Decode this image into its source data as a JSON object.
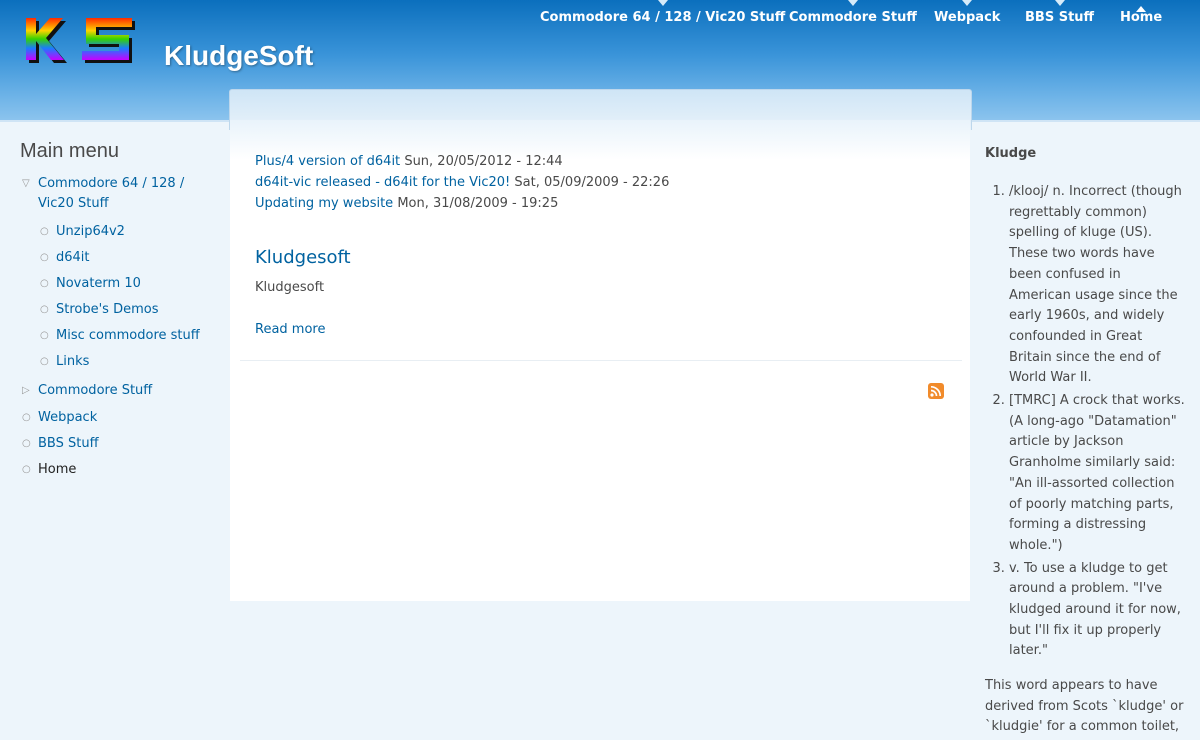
{
  "site": {
    "name": "KludgeSoft",
    "logo_text": "KS",
    "logo_colors": [
      "#ff2a00",
      "#ffd200",
      "#35d300",
      "#1a7cff",
      "#c800ff"
    ]
  },
  "nav": {
    "items": [
      {
        "label": "Commodore 64 / 128 / Vic20 Stuff"
      },
      {
        "label": "Commodore Stuff"
      },
      {
        "label": "Webpack"
      },
      {
        "label": "BBS Stuff"
      },
      {
        "label": "Home"
      }
    ]
  },
  "sidebar_left": {
    "title": "Main menu",
    "items": [
      {
        "label": "Commodore 64 / 128 /",
        "label2": "Vic20 Stuff",
        "bullet": "▽"
      },
      {
        "label": "Unzip64v2",
        "bullet": "○"
      },
      {
        "label": "d64it",
        "bullet": "○"
      },
      {
        "label": "Novaterm 10",
        "bullet": "○"
      },
      {
        "label": "Strobe's Demos",
        "bullet": "○"
      },
      {
        "label": "Misc commodore stuff",
        "bullet": "○"
      },
      {
        "label": "Links",
        "bullet": "○"
      },
      {
        "label": "Commodore Stuff",
        "bullet": "▷"
      },
      {
        "label": "Webpack",
        "bullet": "○"
      },
      {
        "label": "BBS Stuff",
        "bullet": "○"
      },
      {
        "label": "Home",
        "bullet": "○"
      }
    ]
  },
  "content": {
    "recent": [
      {
        "title": "Plus/4 version of d64it",
        "date": "Sun, 20/05/2012 - 12:44"
      },
      {
        "title": "d64it-vic released - d64it for the Vic20!",
        "date": "Sat, 05/09/2009 - 22:26"
      },
      {
        "title": "Updating my website",
        "date": "Mon, 31/08/2009 - 19:25"
      }
    ],
    "node": {
      "title": "Kludgesoft",
      "body": "Kludgesoft",
      "read_more": "Read more"
    }
  },
  "sidebar_right": {
    "title": "Kludge",
    "definitions": [
      "/klooj/ n. Incorrect (though regrettably common) spelling of kluge (US). These two words have been confused in American usage since the early 1960s, and widely confounded in Great Britain since the end of World War II.",
      "[TMRC] A crock that works. (A long-ago \"Datamation\" article by Jackson Granholme similarly said: \"An ill-assorted collection of poorly matching parts, forming a distressing whole.\")",
      "v. To use a kludge to get around a problem. \"I've kludged around it for now, but I'll fix it up properly later.\""
    ],
    "origin": "This word appears to have derived from Scots `kludge' or `kludgie' for a common toilet,"
  },
  "colors": {
    "link": "#0062a0",
    "header_top": "#0b6fbd",
    "rss": "#f18b2b"
  }
}
